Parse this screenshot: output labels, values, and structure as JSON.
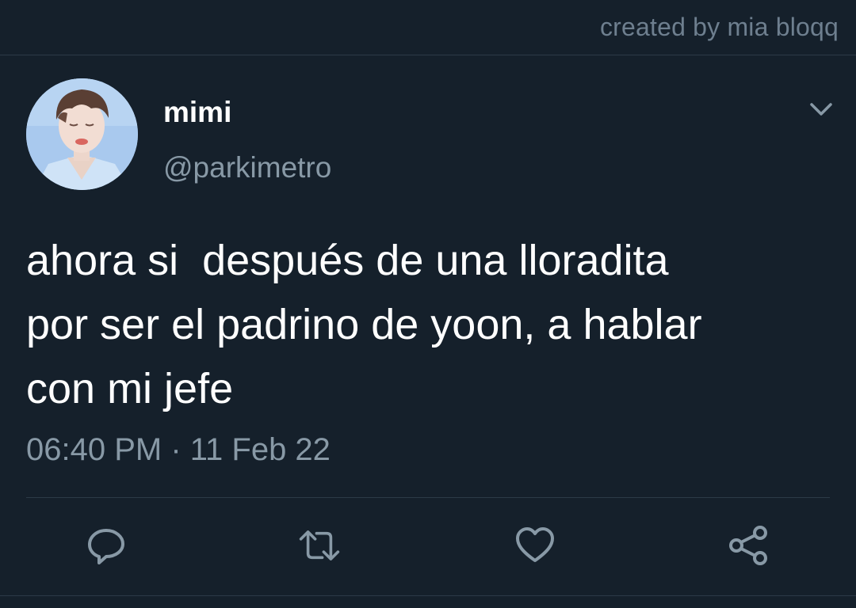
{
  "watermark": "created by mia bloqq",
  "tweet": {
    "author": {
      "display_name": "mimi",
      "handle": "@parkimetro",
      "avatar_icon": "profile-photo"
    },
    "text": "ahora si  después de una lloradita\npor ser el padrino de yoon, a hablar\ncon mi jefe",
    "timestamp": "06:40 PM · 11 Feb 22",
    "menu_icon": "chevron-down-icon"
  },
  "actions": [
    {
      "name": "reply",
      "icon": "reply-icon"
    },
    {
      "name": "retweet",
      "icon": "retweet-icon"
    },
    {
      "name": "like",
      "icon": "heart-icon"
    },
    {
      "name": "share",
      "icon": "share-icon"
    }
  ],
  "colors": {
    "background": "#15202b",
    "text_primary": "#ffffff",
    "text_secondary": "#8899a6",
    "divider": "#2c3a47",
    "icon": "#8899a6"
  }
}
